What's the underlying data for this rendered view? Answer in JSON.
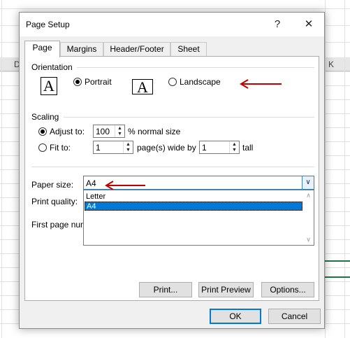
{
  "background": {
    "col_letters": [
      "D",
      "K"
    ]
  },
  "dialog": {
    "title": "Page Setup",
    "help_glyph": "?",
    "close_glyph": "✕",
    "tabs": [
      "Page",
      "Margins",
      "Header/Footer",
      "Sheet"
    ],
    "orientation": {
      "label": "Orientation",
      "icon_letter": "A",
      "portrait": "Portrait",
      "landscape": "Landscape",
      "selected": "Portrait"
    },
    "scaling": {
      "label": "Scaling",
      "adjust_to_label": "Adjust to:",
      "adjust_to_value": "100",
      "percent_label": "% normal size",
      "fit_to_label": "Fit to:",
      "fit_wide_value": "1",
      "pages_wide_label": "page(s) wide by",
      "fit_tall_value": "1",
      "tall_label": "tall",
      "selected": "Adjust to"
    },
    "paper_size": {
      "label": "Paper size:",
      "value": "A4",
      "options": [
        "Letter",
        "A4"
      ],
      "selected_option": "A4"
    },
    "print_quality_label": "Print quality:",
    "first_page_label": "First page num",
    "buttons": {
      "print": "Print...",
      "print_preview": "Print Preview",
      "options": "Options...",
      "ok": "OK",
      "cancel": "Cancel"
    },
    "annotation_color": "#c00000",
    "accent_color": "#0078d7"
  }
}
